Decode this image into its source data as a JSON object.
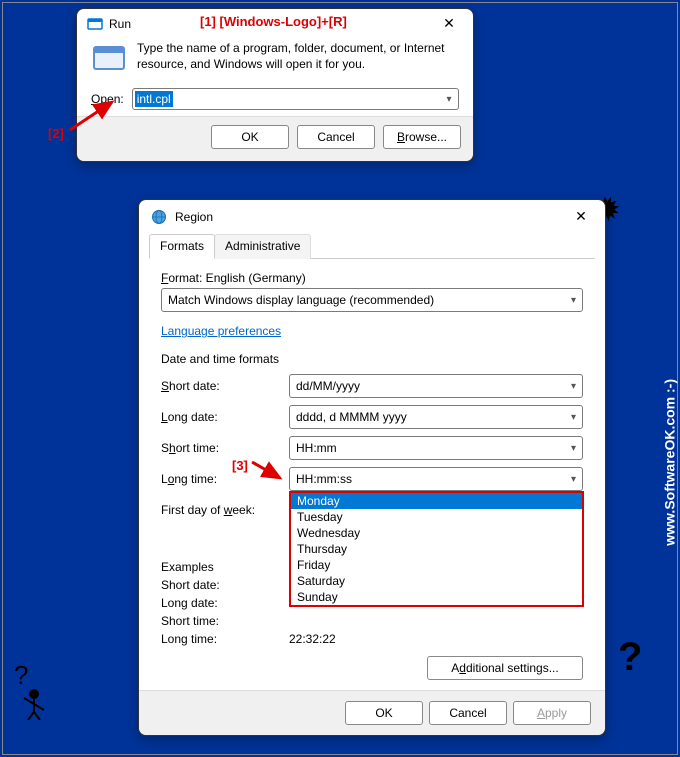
{
  "annotations": {
    "a1": "[1]  [Windows-Logo]+[R]",
    "a2": "[2]",
    "a3": "[3]"
  },
  "run": {
    "title": "Run",
    "description": "Type the name of a program, folder, document, or Internet resource, and Windows will open it for you.",
    "open_label": "Open:",
    "open_hotkey": "O",
    "command": "intl.cpl",
    "ok": "OK",
    "cancel": "Cancel",
    "browse": "Browse..."
  },
  "region": {
    "title": "Region",
    "tabs": {
      "formats": "Formats",
      "admin": "Administrative"
    },
    "format_label": "Format: English (Germany)",
    "format_value": "Match Windows display language (recommended)",
    "lang_pref": "Language preferences",
    "group_dt": "Date and time formats",
    "rows": {
      "short_date": {
        "label": "Short date:",
        "value": "dd/MM/yyyy"
      },
      "long_date": {
        "label": "Long date:",
        "value": "dddd, d MMMM yyyy"
      },
      "short_time": {
        "label": "Short time:",
        "value": "HH:mm"
      },
      "long_time": {
        "label": "Long time:",
        "value": "HH:mm:ss"
      },
      "first_day": {
        "label": "First day of week:",
        "value": "Monday"
      }
    },
    "days": [
      "Monday",
      "Tuesday",
      "Wednesday",
      "Thursday",
      "Friday",
      "Saturday",
      "Sunday"
    ],
    "examples_title": "Examples",
    "examples": {
      "short_date": {
        "label": "Short date:",
        "value": ""
      },
      "long_date": {
        "label": "Long date:",
        "value": ""
      },
      "short_time": {
        "label": "Short time:",
        "value": ""
      },
      "long_time": {
        "label": "Long time:",
        "value": "22:32:22"
      }
    },
    "additional": "Additional settings...",
    "ok": "OK",
    "cancel": "Cancel",
    "apply": "Apply"
  },
  "watermark": "SoftwareOK",
  "side_text": "www.SoftwareOK.com :-)"
}
